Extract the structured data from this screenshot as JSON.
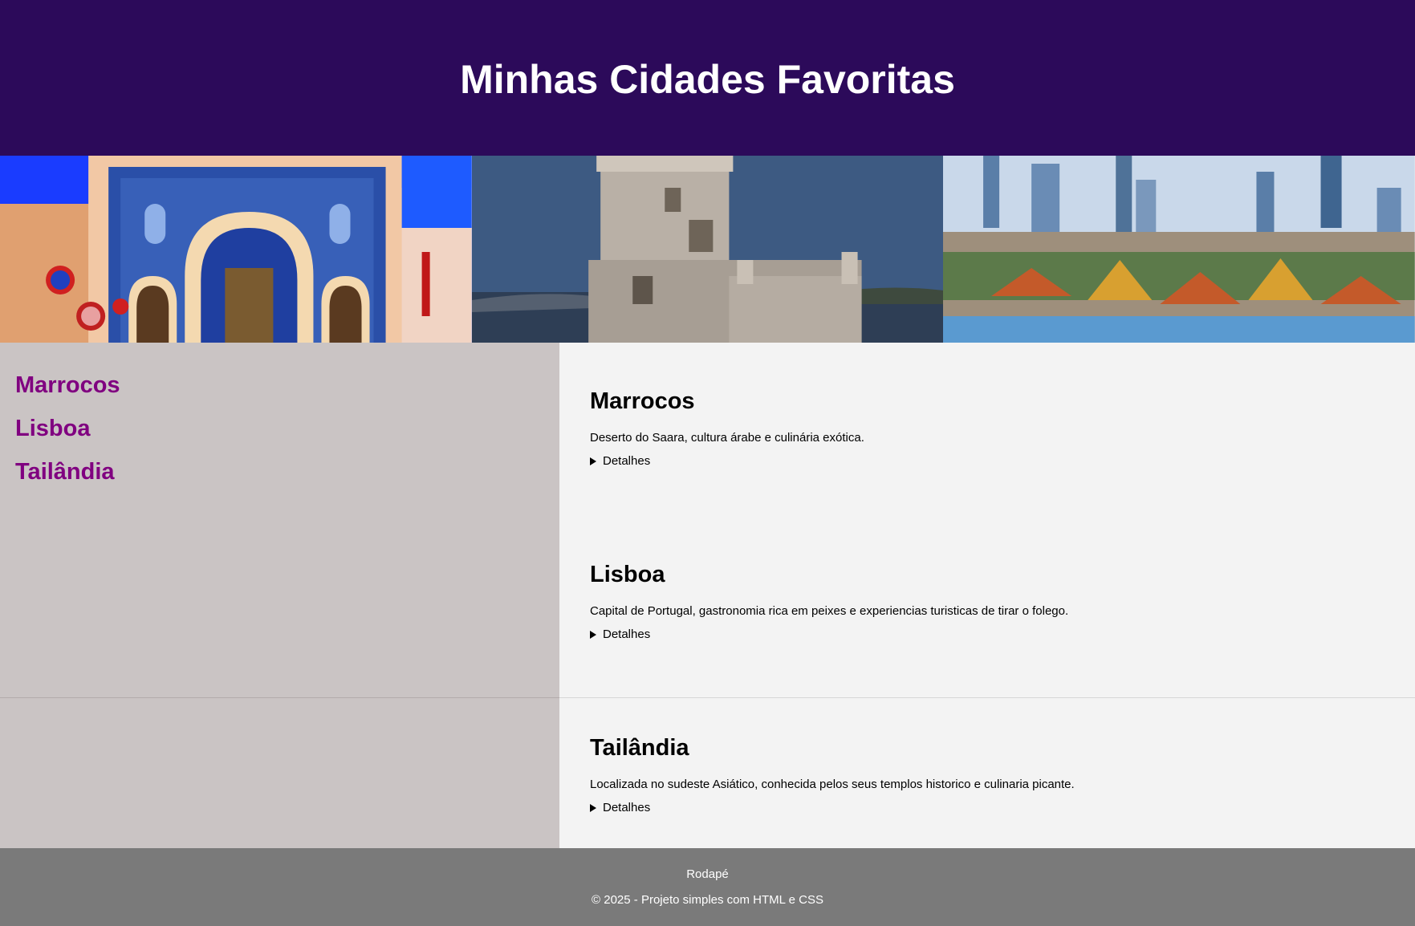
{
  "header": {
    "title": "Minhas Cidades Favoritas"
  },
  "banner": {
    "images": [
      {
        "icon": "morocco-gate-photo"
      },
      {
        "icon": "lisbon-belem-tower-photo"
      },
      {
        "icon": "bangkok-skyline-photo"
      }
    ]
  },
  "sidebar": {
    "links": [
      {
        "label": "Marrocos"
      },
      {
        "label": "Lisboa"
      },
      {
        "label": "Tailândia"
      }
    ]
  },
  "sections": [
    {
      "title": "Marrocos",
      "description": "Deserto do Saara, cultura árabe e culinária exótica.",
      "details": "Detalhes"
    },
    {
      "title": "Lisboa",
      "description": "Capital de Portugal, gastronomia rica em peixes e experiencias turisticas de tirar o folego.",
      "details": "Detalhes"
    },
    {
      "title": "Tailândia",
      "description": "Localizada no sudeste Asiático, conhecida pelos seus templos historico e culinaria picante.",
      "details": "Detalhes"
    }
  ],
  "footer": {
    "title": "Rodapé",
    "copyright": "© 2025 - Projeto simples com HTML e CSS"
  },
  "colors": {
    "header_bg": "#2c0a5a",
    "sidebar_bg": "#cac4c4",
    "content_bg": "#f3f3f3",
    "link": "#800080",
    "footer_bg": "#7a7a7a"
  }
}
